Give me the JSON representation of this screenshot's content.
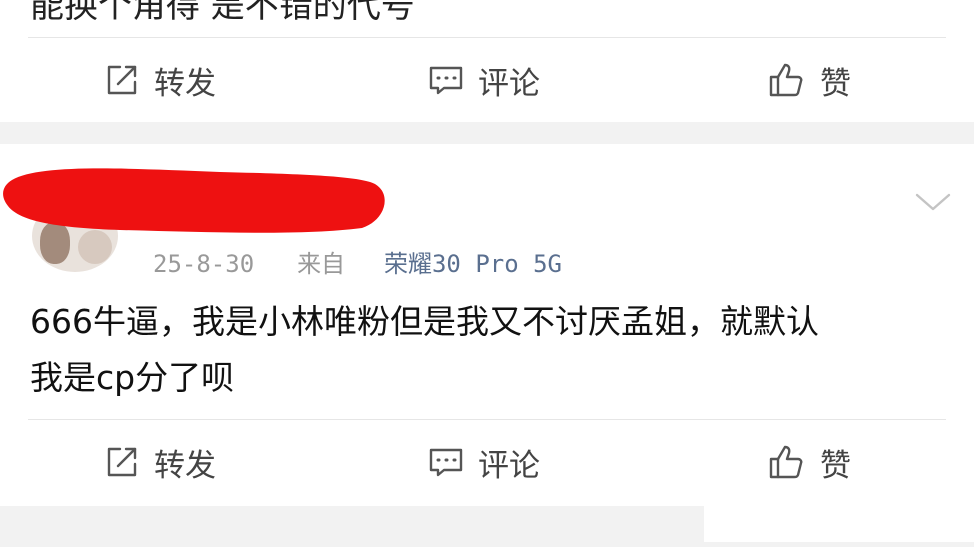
{
  "top_post": {
    "partial_text": "能换个角得 是不错的代号"
  },
  "actions": {
    "repost_label": "转发",
    "comment_label": "评论",
    "like_label": "赞"
  },
  "post": {
    "date": "25-8-30",
    "source_prefix": "来自",
    "source": "荣耀30 Pro 5G",
    "text_line1": "666牛逼，我是小林唯粉但是我又不讨厌孟姐，就默认",
    "text_line2": "我是cp分了呗"
  },
  "icons": {
    "repost": "share-icon",
    "comment": "comment-icon",
    "like": "thumbs-up-icon",
    "menu": "chevron-down-icon"
  },
  "colors": {
    "redaction": "#ee1111",
    "source_link": "#5a6f8f",
    "meta_gray": "#999999"
  }
}
